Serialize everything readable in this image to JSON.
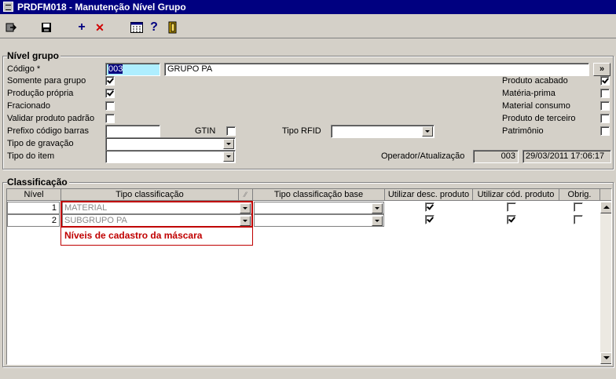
{
  "window": {
    "title": "PRDFM018 - Manutenção Nível Grupo"
  },
  "toolbar": {
    "icons": [
      "exit-icon",
      "save-icon",
      "add-icon",
      "delete-icon",
      "calculator-icon",
      "help-icon",
      "door-icon"
    ],
    "add_glyph": "+",
    "delete_glyph": "✕",
    "help_glyph": "?"
  },
  "nivel_grupo": {
    "title": "Nível grupo",
    "codigo_label": "Código *",
    "codigo_value": "003",
    "descricao_value": "GRUPO PA",
    "lookup_label": "»",
    "somente_para_grupo_label": "Somente para grupo",
    "somente_para_grupo_checked": true,
    "producao_propria_label": "Produção própria",
    "producao_propria_checked": true,
    "fracionado_label": "Fracionado",
    "fracionado_checked": false,
    "validar_produto_padrao_label": "Validar produto padrão",
    "validar_produto_padrao_checked": false,
    "prefixo_codigo_barras_label": "Prefixo código barras",
    "prefixo_codigo_barras_value": "",
    "gtin_label": "GTIN",
    "gtin_checked": false,
    "tipo_rfid_label": "Tipo RFID",
    "tipo_rfid_value": "",
    "tipo_gravacao_label": "Tipo de gravação",
    "tipo_gravacao_value": "",
    "tipo_item_label": "Tipo do item",
    "tipo_item_value": "",
    "produto_acabado_label": "Produto acabado",
    "produto_acabado_checked": true,
    "materia_prima_label": "Matéria-prima",
    "materia_prima_checked": false,
    "material_consumo_label": "Material consumo",
    "material_consumo_checked": false,
    "produto_terceiro_label": "Produto de terceiro",
    "produto_terceiro_checked": false,
    "patrimonio_label": "Patrimônio",
    "patrimonio_checked": false,
    "operador_label": "Operador/Atualização",
    "operador_value": "003",
    "atualizacao_value": "29/03/2011 17:06:17"
  },
  "classificacao": {
    "title": "Classificação",
    "columns": [
      "Nível",
      "Tipo classificação",
      "Tipo classificação base",
      "Utilizar desc. produto",
      "Utilizar cód. produto",
      "Obrig."
    ],
    "sort_glyph": "⁄⁄",
    "rows": [
      {
        "nivel": "1",
        "tipo": "MATERIAL",
        "base": "",
        "desc": true,
        "cod": false,
        "obrig": false
      },
      {
        "nivel": "2",
        "tipo": "SUBGRUPO PA",
        "base": "",
        "desc": true,
        "cod": true,
        "obrig": false
      }
    ],
    "annotation": "Níveis de cadastro da máscara"
  }
}
